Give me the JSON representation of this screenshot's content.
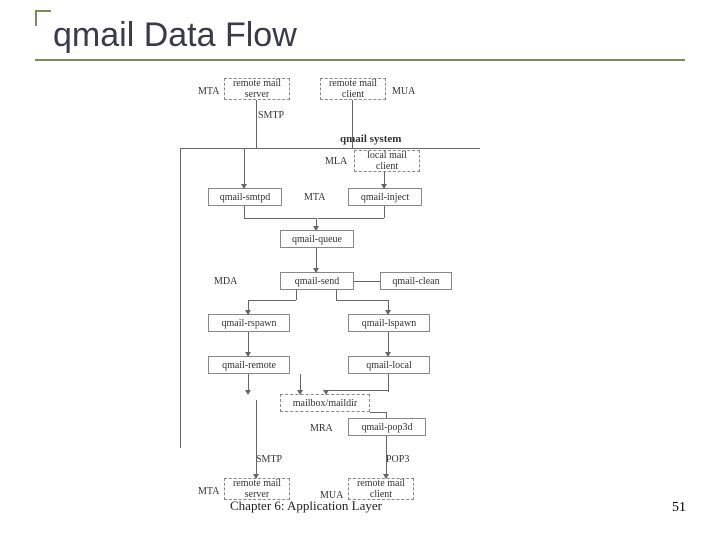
{
  "title": "qmail Data Flow",
  "footer": "Chapter 6: Application Layer",
  "page_number": "51",
  "labels": {
    "mta1": "MTA",
    "mua1": "MUA",
    "smtp1": "SMTP",
    "mla": "MLA",
    "mta2": "MTA",
    "mda": "MDA",
    "mra": "MRA",
    "smtp2": "SMTP",
    "pop3": "POP3",
    "mta3": "MTA",
    "mua2": "MUA"
  },
  "boxes": {
    "remote_server": "remote mail\nserver",
    "remote_client": "remote mail\nclient",
    "qmail_system": "qmail system",
    "local_client": "local mail\nclient",
    "qmail_smtpd": "qmail-smtpd",
    "qmail_inject": "qmail-inject",
    "qmail_queue": "qmail-queue",
    "qmail_send": "qmail-send",
    "qmail_clean": "qmail-clean",
    "qmail_rspawn": "qmail-rspawn",
    "qmail_lspawn": "qmail-lspawn",
    "qmail_remote": "qmail-remote",
    "qmail_local": "qmail-local",
    "mailbox": "mailbox/maildir",
    "qmail_pop3d": "qmail-pop3d",
    "remote_server2": "remote mail\nserver",
    "remote_client2": "remote mail\nclient"
  }
}
